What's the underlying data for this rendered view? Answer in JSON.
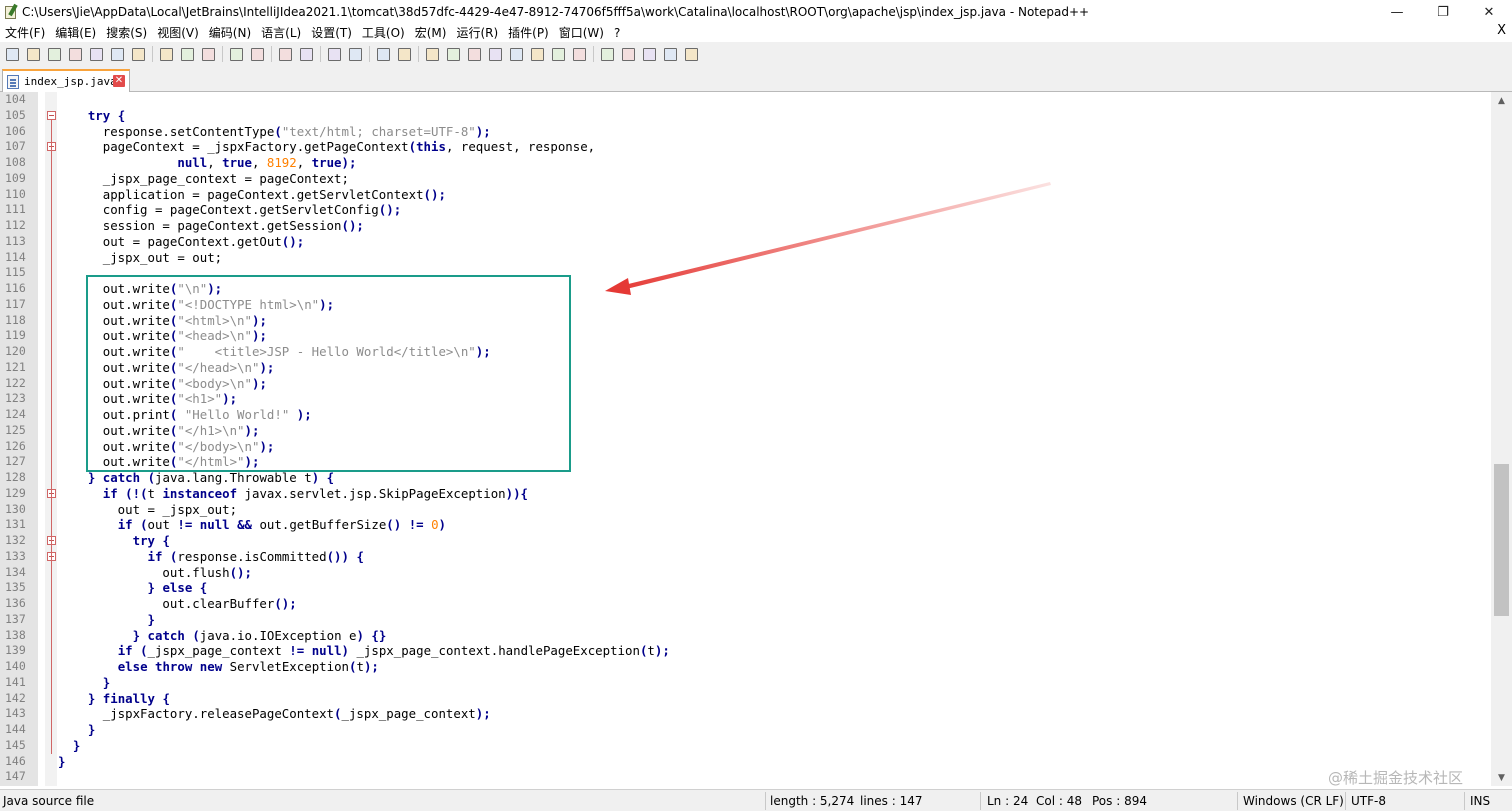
{
  "window": {
    "title": "C:\\Users\\Jie\\AppData\\Local\\JetBrains\\IntelliJIdea2021.1\\tomcat\\38d57dfc-4429-4e47-8912-74706f5fff5a\\work\\Catalina\\localhost\\ROOT\\org\\apache\\jsp\\index_jsp.java - Notepad++",
    "minimize_icon": "minimize-icon",
    "maximize_icon": "restore-icon",
    "close_icon": "close-icon"
  },
  "menu": {
    "items": [
      "文件(F)",
      "编辑(E)",
      "搜索(S)",
      "视图(V)",
      "编码(N)",
      "语言(L)",
      "设置(T)",
      "工具(O)",
      "宏(M)",
      "运行(R)",
      "插件(P)",
      "窗口(W)",
      "?"
    ],
    "close_label": "X"
  },
  "toolbar": {
    "groups": [
      [
        "new-file-icon",
        "open-file-icon",
        "save-icon",
        "save-all-icon",
        "close-icon",
        "close-all-icon",
        "print-icon"
      ],
      [
        "cut-icon",
        "copy-icon",
        "paste-icon"
      ],
      [
        "undo-icon",
        "redo-icon"
      ],
      [
        "find-icon",
        "replace-icon"
      ],
      [
        "zoom-in-icon",
        "zoom-out-icon"
      ],
      [
        "sync-vertical-icon",
        "sync-horizontal-icon"
      ],
      [
        "word-wrap-icon",
        "show-all-chars-icon",
        "indent-guide-icon",
        "udl-icon",
        "doc-map-icon",
        "function-list-icon",
        "folder-workspace-icon",
        "monitor-icon"
      ],
      [
        "record-macro-icon",
        "stop-record-icon",
        "play-macro-icon",
        "run-macro-multiple-icon",
        "save-macro-icon"
      ]
    ]
  },
  "tab": {
    "label": "index_jsp.java",
    "close_icon": "tab-close-icon"
  },
  "editor": {
    "lines": [
      {
        "n": "104",
        "code": [],
        "fold": ""
      },
      {
        "n": "105",
        "fold": "box",
        "code": [
          [
            "",
            "    "
          ],
          [
            "kw",
            "try"
          ],
          [
            "",
            " "
          ],
          [
            "op",
            "{"
          ]
        ]
      },
      {
        "n": "106",
        "fold": "",
        "code": [
          [
            "",
            "      response.setContentType"
          ],
          [
            "op",
            "("
          ],
          [
            "str",
            "\"text/html; charset=UTF-8\""
          ],
          [
            "op",
            ");"
          ]
        ]
      },
      {
        "n": "107",
        "fold": "box",
        "code": [
          [
            "",
            "      pageContext = _jspxFactory.getPageContext"
          ],
          [
            "op",
            "("
          ],
          [
            "kw",
            "this"
          ],
          [
            "",
            ", request, response,"
          ]
        ]
      },
      {
        "n": "108",
        "fold": "",
        "code": [
          [
            "",
            "                "
          ],
          [
            "kw",
            "null"
          ],
          [
            "",
            ", "
          ],
          [
            "kw",
            "true"
          ],
          [
            "",
            ", "
          ],
          [
            "num",
            "8192"
          ],
          [
            "",
            ", "
          ],
          [
            "kw",
            "true"
          ],
          [
            "op",
            ");"
          ]
        ]
      },
      {
        "n": "109",
        "fold": "",
        "code": [
          [
            "",
            "      _jspx_page_context = pageContext;"
          ]
        ]
      },
      {
        "n": "110",
        "fold": "",
        "code": [
          [
            "",
            "      application = pageContext.getServletContext"
          ],
          [
            "op",
            "();"
          ]
        ]
      },
      {
        "n": "111",
        "fold": "",
        "code": [
          [
            "",
            "      config = pageContext.getServletConfig"
          ],
          [
            "op",
            "();"
          ]
        ]
      },
      {
        "n": "112",
        "fold": "",
        "code": [
          [
            "",
            "      session = pageContext.getSession"
          ],
          [
            "op",
            "();"
          ]
        ]
      },
      {
        "n": "113",
        "fold": "",
        "code": [
          [
            "",
            "      out = pageContext.getOut"
          ],
          [
            "op",
            "();"
          ]
        ]
      },
      {
        "n": "114",
        "fold": "",
        "code": [
          [
            "",
            "      _jspx_out = out;"
          ]
        ]
      },
      {
        "n": "115",
        "fold": "",
        "code": []
      },
      {
        "n": "116",
        "fold": "",
        "code": [
          [
            "",
            "      out.write"
          ],
          [
            "op",
            "("
          ],
          [
            "str",
            "\"\\n\""
          ],
          [
            "op",
            ");"
          ]
        ]
      },
      {
        "n": "117",
        "fold": "",
        "code": [
          [
            "",
            "      out.write"
          ],
          [
            "op",
            "("
          ],
          [
            "str",
            "\"<!DOCTYPE html>\\n\""
          ],
          [
            "op",
            ");"
          ]
        ]
      },
      {
        "n": "118",
        "fold": "",
        "code": [
          [
            "",
            "      out.write"
          ],
          [
            "op",
            "("
          ],
          [
            "str",
            "\"<html>\\n\""
          ],
          [
            "op",
            ");"
          ]
        ]
      },
      {
        "n": "119",
        "fold": "",
        "code": [
          [
            "",
            "      out.write"
          ],
          [
            "op",
            "("
          ],
          [
            "str",
            "\"<head>\\n\""
          ],
          [
            "op",
            ");"
          ]
        ]
      },
      {
        "n": "120",
        "fold": "",
        "code": [
          [
            "",
            "      out.write"
          ],
          [
            "op",
            "("
          ],
          [
            "str",
            "\"    <title>JSP - Hello World</title>\\n\""
          ],
          [
            "op",
            ");"
          ]
        ]
      },
      {
        "n": "121",
        "fold": "",
        "code": [
          [
            "",
            "      out.write"
          ],
          [
            "op",
            "("
          ],
          [
            "str",
            "\"</head>\\n\""
          ],
          [
            "op",
            ");"
          ]
        ]
      },
      {
        "n": "122",
        "fold": "",
        "code": [
          [
            "",
            "      out.write"
          ],
          [
            "op",
            "("
          ],
          [
            "str",
            "\"<body>\\n\""
          ],
          [
            "op",
            ");"
          ]
        ]
      },
      {
        "n": "123",
        "fold": "",
        "code": [
          [
            "",
            "      out.write"
          ],
          [
            "op",
            "("
          ],
          [
            "str",
            "\"<h1>\""
          ],
          [
            "op",
            ");"
          ]
        ]
      },
      {
        "n": "124",
        "fold": "",
        "code": [
          [
            "",
            "      out.print"
          ],
          [
            "op",
            "("
          ],
          [
            "",
            " "
          ],
          [
            "str",
            "\"Hello World!\""
          ],
          [
            "",
            " "
          ],
          [
            "op",
            ");"
          ]
        ]
      },
      {
        "n": "125",
        "fold": "",
        "code": [
          [
            "",
            "      out.write"
          ],
          [
            "op",
            "("
          ],
          [
            "str",
            "\"</h1>\\n\""
          ],
          [
            "op",
            ");"
          ]
        ]
      },
      {
        "n": "126",
        "fold": "",
        "code": [
          [
            "",
            "      out.write"
          ],
          [
            "op",
            "("
          ],
          [
            "str",
            "\"</body>\\n\""
          ],
          [
            "op",
            ");"
          ]
        ]
      },
      {
        "n": "127",
        "fold": "",
        "code": [
          [
            "",
            "      out.write"
          ],
          [
            "op",
            "("
          ],
          [
            "str",
            "\"</html>\""
          ],
          [
            "op",
            ");"
          ]
        ]
      },
      {
        "n": "128",
        "fold": "",
        "code": [
          [
            "",
            "    "
          ],
          [
            "op",
            "}"
          ],
          [
            "",
            " "
          ],
          [
            "kw",
            "catch"
          ],
          [
            "",
            " "
          ],
          [
            "op",
            "("
          ],
          [
            "",
            "java.lang.Throwable t"
          ],
          [
            "op",
            ")"
          ],
          [
            "",
            " "
          ],
          [
            "op",
            "{"
          ]
        ]
      },
      {
        "n": "129",
        "fold": "box",
        "code": [
          [
            "",
            "      "
          ],
          [
            "kw",
            "if"
          ],
          [
            "",
            " "
          ],
          [
            "op",
            "(!("
          ],
          [
            "",
            "t "
          ],
          [
            "kw",
            "instanceof"
          ],
          [
            "",
            " javax.servlet.jsp.SkipPageException"
          ],
          [
            "op",
            ")){"
          ]
        ]
      },
      {
        "n": "130",
        "fold": "",
        "code": [
          [
            "",
            "        out = _jspx_out;"
          ]
        ]
      },
      {
        "n": "131",
        "fold": "",
        "code": [
          [
            "",
            "        "
          ],
          [
            "kw",
            "if"
          ],
          [
            "",
            " "
          ],
          [
            "op",
            "("
          ],
          [
            "",
            "out "
          ],
          [
            "op",
            "!="
          ],
          [
            "",
            " "
          ],
          [
            "kw",
            "null"
          ],
          [
            "",
            " "
          ],
          [
            "op",
            "&&"
          ],
          [
            "",
            " out.getBufferSize"
          ],
          [
            "op",
            "()"
          ],
          [
            "",
            " "
          ],
          [
            "op",
            "!="
          ],
          [
            "",
            " "
          ],
          [
            "num",
            "0"
          ],
          [
            "op",
            ")"
          ]
        ]
      },
      {
        "n": "132",
        "fold": "box",
        "code": [
          [
            "",
            "          "
          ],
          [
            "kw",
            "try"
          ],
          [
            "",
            " "
          ],
          [
            "op",
            "{"
          ]
        ]
      },
      {
        "n": "133",
        "fold": "box",
        "code": [
          [
            "",
            "            "
          ],
          [
            "kw",
            "if"
          ],
          [
            "",
            " "
          ],
          [
            "op",
            "("
          ],
          [
            "",
            "response.isCommitted"
          ],
          [
            "op",
            "())"
          ],
          [
            "",
            " "
          ],
          [
            "op",
            "{"
          ]
        ]
      },
      {
        "n": "134",
        "fold": "",
        "code": [
          [
            "",
            "              out.flush"
          ],
          [
            "op",
            "();"
          ]
        ]
      },
      {
        "n": "135",
        "fold": "",
        "code": [
          [
            "",
            "            "
          ],
          [
            "op",
            "}"
          ],
          [
            "",
            " "
          ],
          [
            "kw",
            "else"
          ],
          [
            "",
            " "
          ],
          [
            "op",
            "{"
          ]
        ]
      },
      {
        "n": "136",
        "fold": "",
        "code": [
          [
            "",
            "              out.clearBuffer"
          ],
          [
            "op",
            "();"
          ]
        ]
      },
      {
        "n": "137",
        "fold": "",
        "code": [
          [
            "",
            "            "
          ],
          [
            "op",
            "}"
          ]
        ]
      },
      {
        "n": "138",
        "fold": "",
        "code": [
          [
            "",
            "          "
          ],
          [
            "op",
            "}"
          ],
          [
            "",
            " "
          ],
          [
            "kw",
            "catch"
          ],
          [
            "",
            " "
          ],
          [
            "op",
            "("
          ],
          [
            "",
            "java.io.IOException e"
          ],
          [
            "op",
            ")"
          ],
          [
            "",
            " "
          ],
          [
            "op",
            "{}"
          ]
        ]
      },
      {
        "n": "139",
        "fold": "",
        "code": [
          [
            "",
            "        "
          ],
          [
            "kw",
            "if"
          ],
          [
            "",
            " "
          ],
          [
            "op",
            "("
          ],
          [
            "",
            "_jspx_page_context "
          ],
          [
            "op",
            "!="
          ],
          [
            "",
            " "
          ],
          [
            "kw",
            "null"
          ],
          [
            "op",
            ")"
          ],
          [
            "",
            " _jspx_page_context.handlePageException"
          ],
          [
            "op",
            "("
          ],
          [
            "",
            "t"
          ],
          [
            "op",
            ");"
          ]
        ]
      },
      {
        "n": "140",
        "fold": "",
        "code": [
          [
            "",
            "        "
          ],
          [
            "kw",
            "else"
          ],
          [
            "",
            " "
          ],
          [
            "kw",
            "throw"
          ],
          [
            "",
            " "
          ],
          [
            "kw",
            "new"
          ],
          [
            "",
            " ServletException"
          ],
          [
            "op",
            "("
          ],
          [
            "",
            "t"
          ],
          [
            "op",
            ");"
          ]
        ]
      },
      {
        "n": "141",
        "fold": "",
        "code": [
          [
            "",
            "      "
          ],
          [
            "op",
            "}"
          ]
        ]
      },
      {
        "n": "142",
        "fold": "",
        "code": [
          [
            "",
            "    "
          ],
          [
            "op",
            "}"
          ],
          [
            "",
            " "
          ],
          [
            "kw",
            "finally"
          ],
          [
            "",
            " "
          ],
          [
            "op",
            "{"
          ]
        ]
      },
      {
        "n": "143",
        "fold": "",
        "code": [
          [
            "",
            "      _jspxFactory.releasePageContext"
          ],
          [
            "op",
            "("
          ],
          [
            "",
            "_jspx_page_context"
          ],
          [
            "op",
            ");"
          ]
        ]
      },
      {
        "n": "144",
        "fold": "",
        "code": [
          [
            "",
            "    "
          ],
          [
            "op",
            "}"
          ]
        ]
      },
      {
        "n": "145",
        "fold": "",
        "code": [
          [
            "",
            "  "
          ],
          [
            "op",
            "}"
          ]
        ]
      },
      {
        "n": "146",
        "fold": "",
        "code": [
          [
            "op",
            "}"
          ]
        ]
      },
      {
        "n": "147",
        "fold": "",
        "code": []
      }
    ]
  },
  "annotation": {
    "box_color": "#1a9c8a",
    "arrow_color": "#e53935"
  },
  "status": {
    "file_type": "Java source file",
    "length": "length : 5,274",
    "lines": "lines : 147",
    "ln": "Ln : 24",
    "col": "Col : 48",
    "pos": "Pos : 894",
    "eol": "Windows (CR LF)",
    "encoding": "UTF-8",
    "mode": "INS"
  },
  "watermark": "@稀土掘金技术社区"
}
